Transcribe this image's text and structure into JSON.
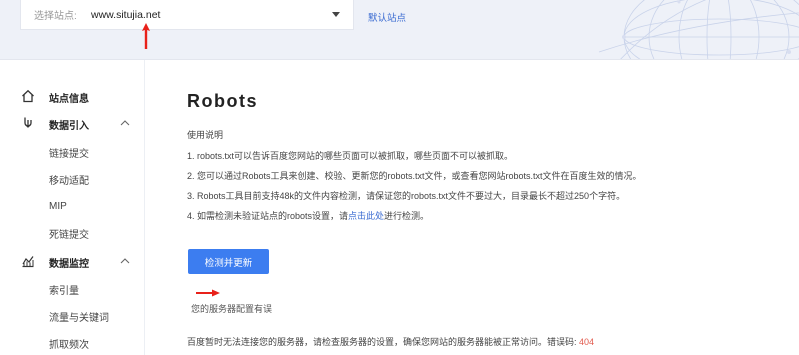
{
  "header": {
    "site_label": "选择站点:",
    "site_value": "www.situjia.net",
    "default_site_link": "默认站点"
  },
  "sidebar": {
    "items": [
      {
        "label": "站点信息",
        "type": "head",
        "icon": "home-icon"
      },
      {
        "label": "数据引入",
        "type": "head",
        "icon": "data-import-icon",
        "expanded": true
      },
      {
        "label": "链接提交",
        "type": "sub"
      },
      {
        "label": "移动适配",
        "type": "sub"
      },
      {
        "label": "MIP",
        "type": "sub"
      },
      {
        "label": "死链提交",
        "type": "sub"
      },
      {
        "label": "数据监控",
        "type": "head",
        "icon": "chart-icon",
        "expanded": true
      },
      {
        "label": "索引量",
        "type": "sub"
      },
      {
        "label": "流量与关键词",
        "type": "sub"
      },
      {
        "label": "抓取频次",
        "type": "sub"
      }
    ]
  },
  "main": {
    "title": "Robots",
    "usage_heading": "使用说明",
    "instructions": [
      "1. robots.txt可以告诉百度您网站的哪些页面可以被抓取，哪些页面不可以被抓取。",
      "2. 您可以通过Robots工具来创建、校验、更新您的robots.txt文件，或查看您网站robots.txt文件在百度生效的情况。",
      "3. Robots工具目前支持48k的文件内容检测，请保证您的robots.txt文件不要过大，目录最长不超过250个字符。"
    ],
    "instruction4_prefix": "4. 如需检测未验证站点的robots设置，请",
    "instruction4_link": "点击此处",
    "instruction4_suffix": "进行检测。",
    "check_button": "检测并更新",
    "error_title": "您的服务器配置有误",
    "error_desc": "百度暂时无法连接您的服务器，请检查服务器的设置，确保您网站的服务器能被正常访问。错误码:",
    "error_code": "404"
  },
  "colors": {
    "accent": "#3c7df0",
    "link": "#3a6bd1",
    "error": "#e25a4d",
    "annotation_arrow": "#e8211a"
  }
}
